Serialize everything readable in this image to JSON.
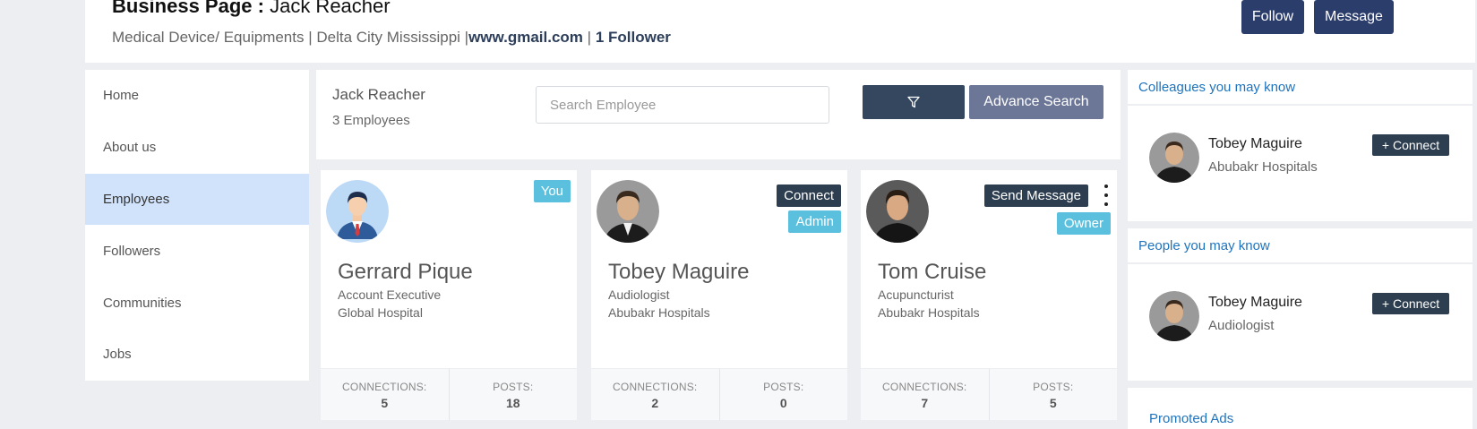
{
  "header": {
    "title_prefix": "Business Page :",
    "title_name": "Jack Reacher",
    "meta_text": "Medical Device/ Equipments | Delta City Mississippi |",
    "website": "www.gmail.com",
    "separator": "|",
    "followers": "1 Follower",
    "follow_label": "Follow",
    "message_label": "Message"
  },
  "sidebar": {
    "items": [
      {
        "label": "Home"
      },
      {
        "label": "About us"
      },
      {
        "label": "Employees"
      },
      {
        "label": "Followers"
      },
      {
        "label": "Communities"
      },
      {
        "label": "Jobs"
      }
    ],
    "active": "Employees"
  },
  "employees_panel": {
    "company": "Jack Reacher",
    "count": "3 Employees",
    "search_placeholder": "Search Employee",
    "filter_icon": "filter-icon",
    "advance_search_label": "Advance Search"
  },
  "cards": [
    {
      "name": "Gerrard Pique",
      "role": "Account Executive",
      "org": "Global Hospital",
      "badge": "You",
      "connections_label": "CONNECTIONS:",
      "connections": "5",
      "posts_label": "POSTS:",
      "posts": "18"
    },
    {
      "name": "Tobey Maguire",
      "role": "Audiologist",
      "org": "Abubakr Hospitals",
      "action": "Connect",
      "badge": "Admin",
      "connections_label": "CONNECTIONS:",
      "connections": "2",
      "posts_label": "POSTS:",
      "posts": "0"
    },
    {
      "name": "Tom Cruise",
      "role": "Acupuncturist",
      "org": "Abubakr Hospitals",
      "action": "Send Message",
      "badge": "Owner",
      "connections_label": "CONNECTIONS:",
      "connections": "7",
      "posts_label": "POSTS:",
      "posts": "5"
    }
  ],
  "right": {
    "colleagues": {
      "title": "Colleagues you may know",
      "name": "Tobey Maguire",
      "sub": "Abubakr Hospitals",
      "connect_label": "+ Connect"
    },
    "people": {
      "title": "People you may know",
      "name": "Tobey Maguire",
      "sub": "Audiologist",
      "connect_label": "+ Connect"
    },
    "promoted": "Promoted Ads"
  },
  "colors": {
    "primary_dark": "#2b3d6b",
    "link_blue": "#1e73be",
    "badge_cyan": "#5bc0de",
    "active_nav": "#d0e3fb"
  }
}
